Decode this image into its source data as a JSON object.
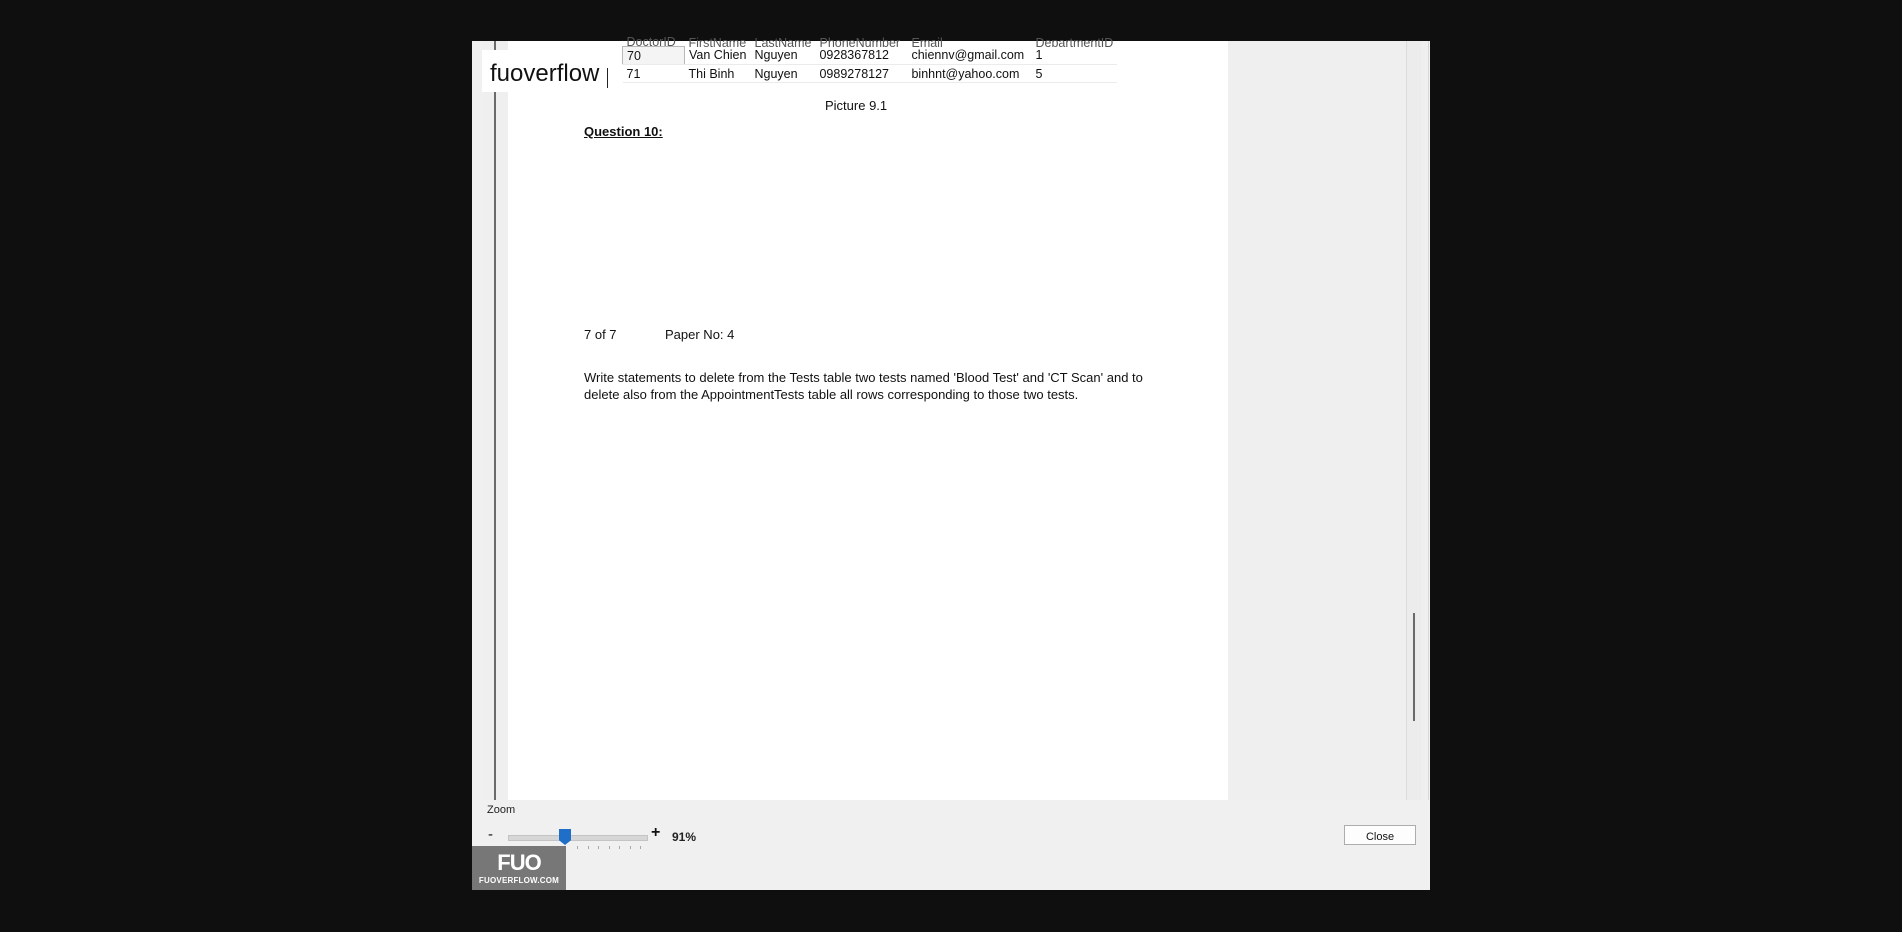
{
  "watermark": {
    "text": "fuoverflow"
  },
  "table": {
    "columns": [
      "DoctorID",
      "FirstName",
      "LastName",
      "PhoneNumber",
      "Email",
      "DepartmentID"
    ],
    "rows": [
      [
        "70",
        "Van Chien",
        "Nguyen",
        "0928367812",
        "chiennv@gmail.com",
        "1"
      ],
      [
        "71",
        "Thi Binh",
        "Nguyen",
        "0989278127",
        "binhnt@yahoo.com",
        "5"
      ]
    ]
  },
  "document": {
    "caption": "Picture 9.1",
    "question_heading": "Question 10:",
    "page_number": "7 of 7",
    "paper_no": "Paper No: 4",
    "question_text": "Write statements to delete from the Tests table two tests named 'Blood Test' and 'CT Scan' and to delete also from the AppointmentTests table all rows corresponding to those two tests."
  },
  "zoom": {
    "label": "Zoom",
    "minus": "-",
    "plus": "+",
    "percent_text": "91%",
    "level_fraction": 0.45
  },
  "close_label": "Close",
  "brand": {
    "logo": "FUO",
    "domain": "FUOVERFLOW.COM"
  },
  "colors": {
    "backdrop": "#0f0f0f",
    "slider_thumb": "#1f6fc8",
    "brand_badge": "#777777"
  }
}
